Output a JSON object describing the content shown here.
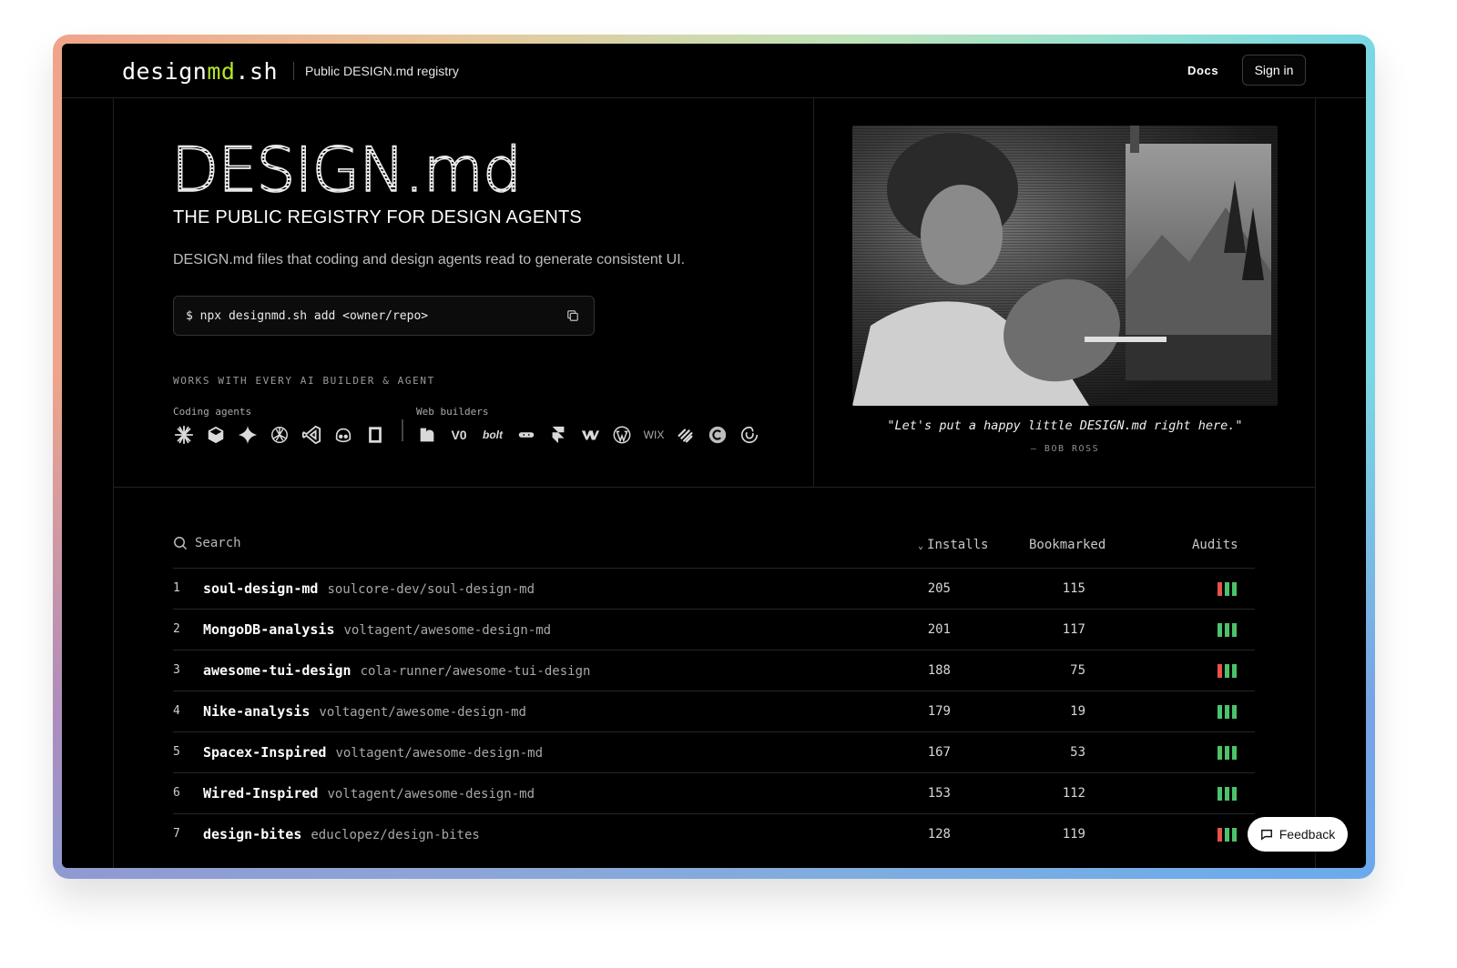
{
  "header": {
    "logo_pre": "design",
    "logo_accent": "md",
    "logo_post": ".sh",
    "tagline": "Public DESIGN.md registry",
    "docs_label": "Docs",
    "signin_label": "Sign in"
  },
  "hero": {
    "title": "DESIGN.md",
    "subtitle": "THE PUBLIC REGISTRY FOR DESIGN AGENTS",
    "description": "DESIGN.md files that coding and design agents read to generate consistent UI.",
    "command": "$ npx designmd.sh add <owner/repo>",
    "works_label": "WORKS WITH EVERY AI BUILDER & AGENT",
    "coding_label": "Coding agents",
    "web_label": "Web builders",
    "web_text_icons": {
      "v0": "V0",
      "bolt": "bolt",
      "wix": "WIX"
    }
  },
  "quote": {
    "text": "\"Let's put a happy little DESIGN.md right here.\"",
    "author": "— BOB ROSS"
  },
  "table": {
    "search_placeholder": "Search",
    "col_installs": "Installs",
    "col_bookmarked": "Bookmarked",
    "col_audits": "Audits",
    "rows": [
      {
        "idx": "1",
        "name": "soul-design-md",
        "repo": "soulcore-dev/soul-design-md",
        "installs": "205",
        "bookmarked": "115",
        "audit": [
          "red",
          "green",
          "green"
        ]
      },
      {
        "idx": "2",
        "name": "MongoDB-analysis",
        "repo": "voltagent/awesome-design-md",
        "installs": "201",
        "bookmarked": "117",
        "audit": [
          "green",
          "green",
          "green"
        ]
      },
      {
        "idx": "3",
        "name": "awesome-tui-design",
        "repo": "cola-runner/awesome-tui-design",
        "installs": "188",
        "bookmarked": "75",
        "audit": [
          "red",
          "green",
          "green"
        ]
      },
      {
        "idx": "4",
        "name": "Nike-analysis",
        "repo": "voltagent/awesome-design-md",
        "installs": "179",
        "bookmarked": "19",
        "audit": [
          "green",
          "green",
          "green"
        ]
      },
      {
        "idx": "5",
        "name": "Spacex-Inspired",
        "repo": "voltagent/awesome-design-md",
        "installs": "167",
        "bookmarked": "53",
        "audit": [
          "green",
          "green",
          "green"
        ]
      },
      {
        "idx": "6",
        "name": "Wired-Inspired",
        "repo": "voltagent/awesome-design-md",
        "installs": "153",
        "bookmarked": "112",
        "audit": [
          "green",
          "green",
          "green"
        ]
      },
      {
        "idx": "7",
        "name": "design-bites",
        "repo": "educlopez/design-bites",
        "installs": "128",
        "bookmarked": "119",
        "audit": [
          "red",
          "green",
          "green"
        ]
      }
    ]
  },
  "feedback_label": "Feedback",
  "colors": {
    "accent": "#b5e62c",
    "audit_red": "#e5534b",
    "audit_green": "#4cc26b"
  }
}
